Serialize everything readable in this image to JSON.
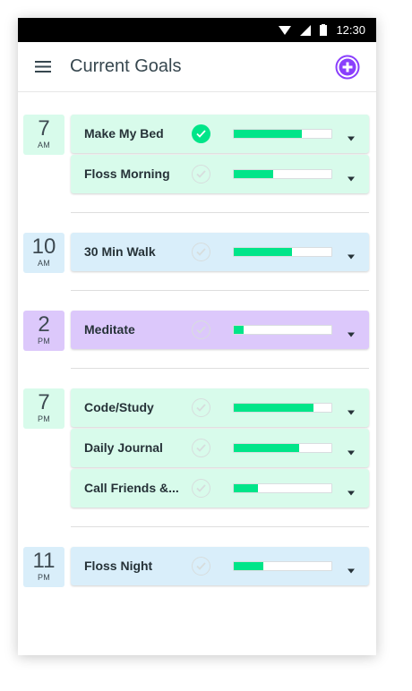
{
  "status_bar": {
    "time": "12:30"
  },
  "header": {
    "title": "Current Goals",
    "menu_icon": "hamburger-icon",
    "add_icon": "plus-circle-icon"
  },
  "colors": {
    "mint": "#d8fbeb",
    "blue": "#d9eefa",
    "purple": "#dcc8fb",
    "accent": "#00e589",
    "add": "#8a3ffc"
  },
  "groups": [
    {
      "hour": "7",
      "ampm": "AM",
      "color": "mint",
      "goals": [
        {
          "name": "Make My Bed",
          "done": true,
          "progress": 0.7
        },
        {
          "name": "Floss Morning",
          "done": false,
          "progress": 0.4
        }
      ]
    },
    {
      "hour": "10",
      "ampm": "AM",
      "color": "blue",
      "goals": [
        {
          "name": "30 Min Walk",
          "done": false,
          "progress": 0.6
        }
      ]
    },
    {
      "hour": "2",
      "ampm": "PM",
      "color": "purple",
      "goals": [
        {
          "name": "Meditate",
          "done": false,
          "progress": 0.1
        }
      ]
    },
    {
      "hour": "7",
      "ampm": "PM",
      "color": "mint",
      "goals": [
        {
          "name": "Code/Study",
          "done": false,
          "progress": 0.82
        },
        {
          "name": "Daily Journal",
          "done": false,
          "progress": 0.67
        },
        {
          "name": "Call Friends &...",
          "done": false,
          "progress": 0.25
        }
      ]
    },
    {
      "hour": "11",
      "ampm": "PM",
      "color": "blue",
      "goals": [
        {
          "name": "Floss Night",
          "done": false,
          "progress": 0.3
        }
      ]
    }
  ]
}
